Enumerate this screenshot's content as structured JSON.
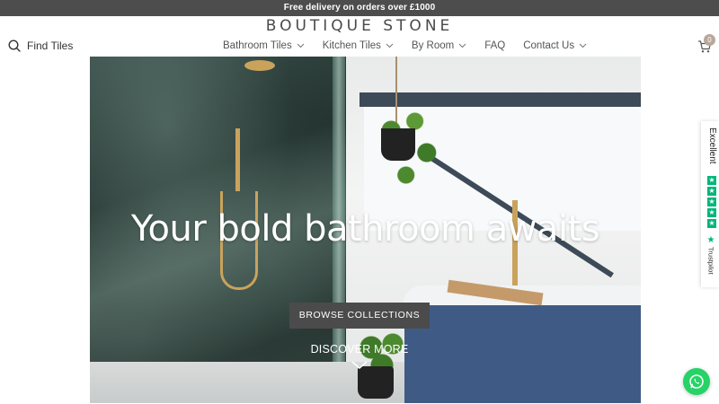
{
  "promo": {
    "text": "Free delivery on orders over £1000"
  },
  "brand": {
    "logo": "BOUTIQUE STONE"
  },
  "search": {
    "label": "Find Tiles",
    "icon": "search-icon"
  },
  "nav": {
    "items": [
      {
        "label": "Bathroom Tiles",
        "has_dropdown": true
      },
      {
        "label": "Kitchen Tiles",
        "has_dropdown": true
      },
      {
        "label": "By Room",
        "has_dropdown": true
      },
      {
        "label": "FAQ",
        "has_dropdown": false
      },
      {
        "label": "Contact Us",
        "has_dropdown": true
      }
    ]
  },
  "cart": {
    "count": "0",
    "icon": "cart-icon"
  },
  "hero": {
    "title": "Your bold bathroom awaits",
    "cta_label": "BROWSE COLLECTIONS",
    "discover_label": "DISCOVER MORE"
  },
  "trustpilot": {
    "rating_label": "Excellent",
    "brand": "Trustpilot",
    "stars": 5
  },
  "whatsapp": {
    "icon": "whatsapp-icon"
  },
  "colors": {
    "promo_bg": "#4d4d4d",
    "button_bg": "#4b4b4b",
    "trustpilot_green": "#00b67a",
    "whatsapp_green": "#25d366",
    "badge": "#b8a89a"
  }
}
